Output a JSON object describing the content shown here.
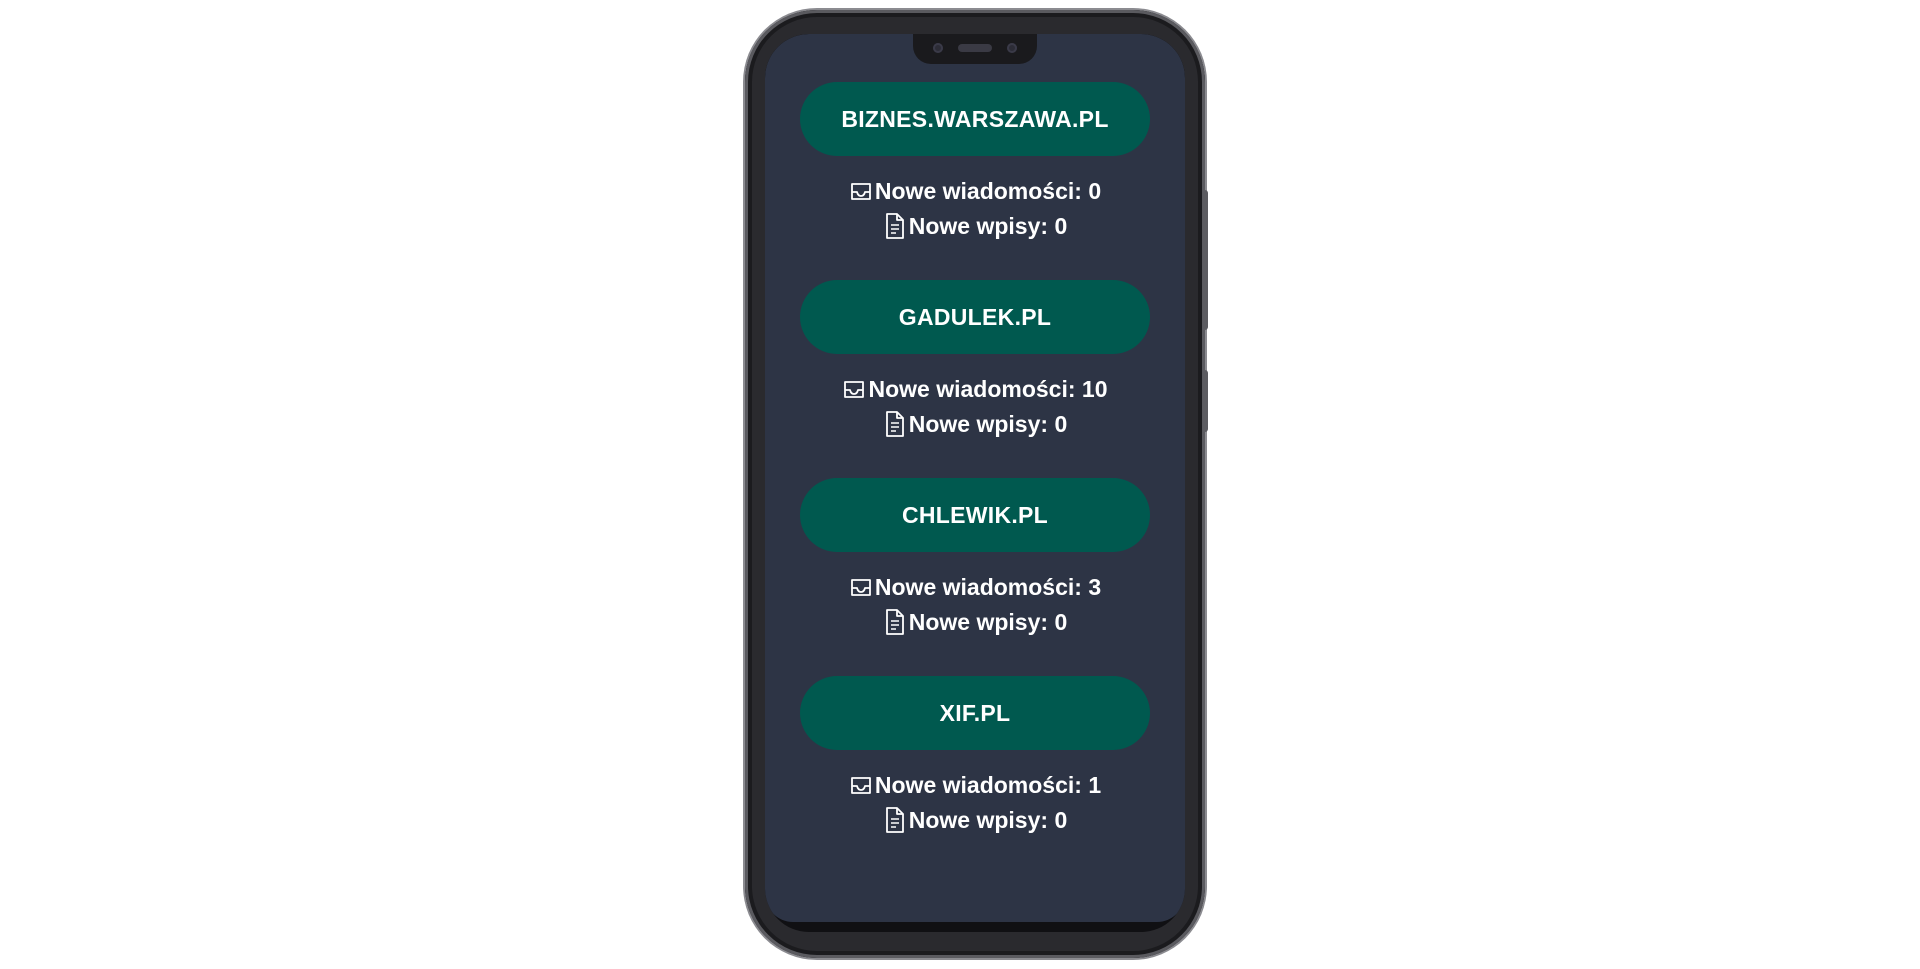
{
  "sites": [
    {
      "name": "BIZNES.WARSZAWA.PL",
      "messages_label": "Nowe wiadomości: 0",
      "entries_label": "Nowe wpisy: 0"
    },
    {
      "name": "GADULEK.PL",
      "messages_label": "Nowe wiadomości: 10",
      "entries_label": "Nowe wpisy: 0"
    },
    {
      "name": "CHLEWIK.PL",
      "messages_label": "Nowe wiadomości: 3",
      "entries_label": "Nowe wpisy: 0"
    },
    {
      "name": "XIF.PL",
      "messages_label": "Nowe wiadomości: 1",
      "entries_label": "Nowe wpisy: 0"
    }
  ],
  "icons": {
    "messages": "inbox-icon",
    "entries": "document-icon"
  },
  "colors": {
    "screen_background": "#2d3445",
    "site_button": "#00594f",
    "text": "#ffffff"
  }
}
